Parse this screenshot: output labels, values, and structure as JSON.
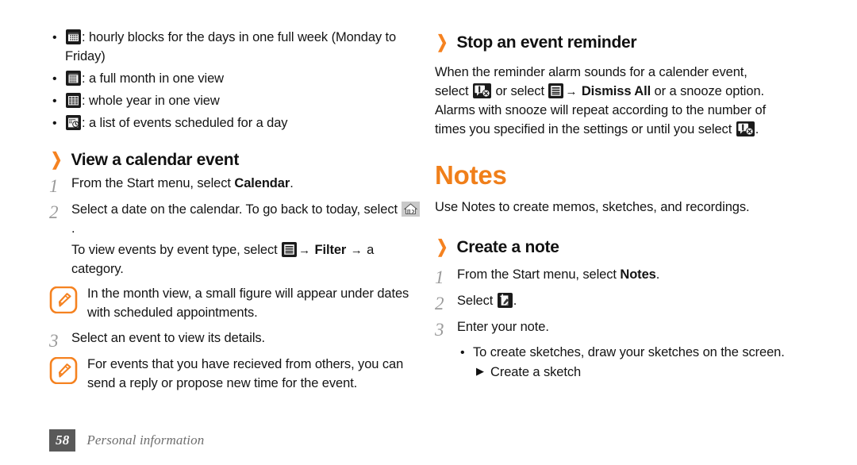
{
  "document": {
    "page_number": "58",
    "footer_section": "Personal information",
    "accent_color": "#F07F1A",
    "page_number_bg": "#595959"
  },
  "left_column": {
    "view_bullets": [
      {
        "icon": "week-view-icon",
        "text": ": hourly blocks for the days in one full week (Monday to Friday)"
      },
      {
        "icon": "month-view-icon",
        "text": ": a full month in one view"
      },
      {
        "icon": "year-view-icon",
        "text": ": whole year in one view"
      },
      {
        "icon": "agenda-view-icon",
        "text": ": a list of events scheduled for a day"
      }
    ],
    "section": {
      "chevron": "❯",
      "heading": "View a calendar event"
    },
    "steps": [
      {
        "num": "1",
        "text_before": "From the Start menu, select ",
        "bold": "Calendar",
        "text_after": "."
      },
      {
        "num": "2",
        "text_before": "Select a date on the calendar. To go back to today, select ",
        "icon": "today-home-icon",
        "text_after": "."
      },
      {
        "num": "3",
        "text_before": "Select an event to view its details.",
        "bold": "",
        "text_after": ""
      }
    ],
    "step2_extra": {
      "before": "To view events by event type, select ",
      "icon": "menu-list-icon",
      "arrow1": "→",
      "bold": "Filter",
      "arrow2": "→",
      "after": " a category."
    },
    "notes": [
      {
        "icon": "note-pen-icon",
        "text": "In the month view, a small figure will appear under dates with scheduled appointments."
      },
      {
        "icon": "note-pen-icon",
        "text": "For events that you have recieved from others, you can send a reply or propose new time for the event."
      }
    ]
  },
  "right_column": {
    "section_stop": {
      "chevron": "❯",
      "heading": "Stop an event reminder"
    },
    "stop_paragraph": {
      "line1": "When the reminder alarm sounds for a calender event,",
      "line2_before": "select ",
      "icon1": "dismiss-alarm-icon",
      "line2_mid": " or select ",
      "icon2": "menu-list-icon",
      "arrow": "→",
      "bold": "Dismiss All",
      "line2_after": " or a snooze option.",
      "line3": "Alarms with snooze will repeat according to the number of",
      "line4_before": "times you specified in the settings or until you select ",
      "icon3": "dismiss-alarm-icon",
      "line4_after": "."
    },
    "chapter_title": "Notes",
    "chapter_intro": "Use Notes to create memos, sketches, and recordings.",
    "section_create": {
      "chevron": "❯",
      "heading": "Create a note"
    },
    "steps": [
      {
        "num": "1",
        "text_before": "From the Start menu, select ",
        "bold": "Notes",
        "text_after": "."
      },
      {
        "num": "2",
        "text_before": "Select ",
        "icon": "new-note-icon",
        "text_after": "."
      },
      {
        "num": "3",
        "text_before": "Enter your note.",
        "text_after": ""
      }
    ],
    "bullets": [
      {
        "dot": "•",
        "text": "To create sketches, draw your sketches on the screen."
      }
    ],
    "subbullet": {
      "triangle": "▶",
      "text": "Create a sketch"
    }
  }
}
